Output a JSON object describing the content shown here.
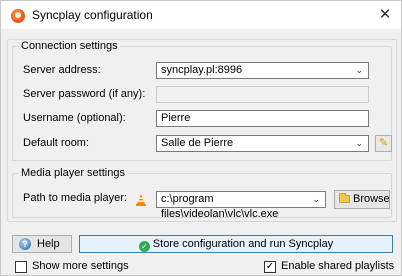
{
  "window": {
    "title": "Syncplay configuration",
    "close_glyph": "✕"
  },
  "connection": {
    "group_title": "Connection settings",
    "server_address": {
      "label": "Server address:",
      "value": "syncplay.pl:8996"
    },
    "server_password": {
      "label": "Server password (if any):",
      "value": ""
    },
    "username": {
      "label": "Username (optional):",
      "value": "Pierre"
    },
    "default_room": {
      "label": "Default room:",
      "value": "Salle de Pierre"
    }
  },
  "media_player": {
    "group_title": "Media player settings",
    "path": {
      "label": "Path to media player:",
      "value": "c:\\program files\\videolan\\vlc\\vlc.exe"
    },
    "browse_label": "Browse"
  },
  "footer": {
    "help_label": "Help",
    "store_label": "Store configuration and run Syncplay",
    "show_more_label": "Show more settings",
    "show_more_checked": false,
    "shared_playlists_label": "Enable shared playlists",
    "shared_playlists_checked": true
  },
  "colors": {
    "accent": "#3c7fb1",
    "store_button_bg": "#e5f1fb",
    "vlc_orange": "#f08b00"
  },
  "icons": {
    "app": "syncplay-logo-icon",
    "close": "close-icon",
    "chevron": "chevron-down-icon",
    "edit": "pencil-icon",
    "vlc": "vlc-cone-icon",
    "browse": "folder-icon",
    "help": "help-icon",
    "store": "check-circle-icon"
  }
}
